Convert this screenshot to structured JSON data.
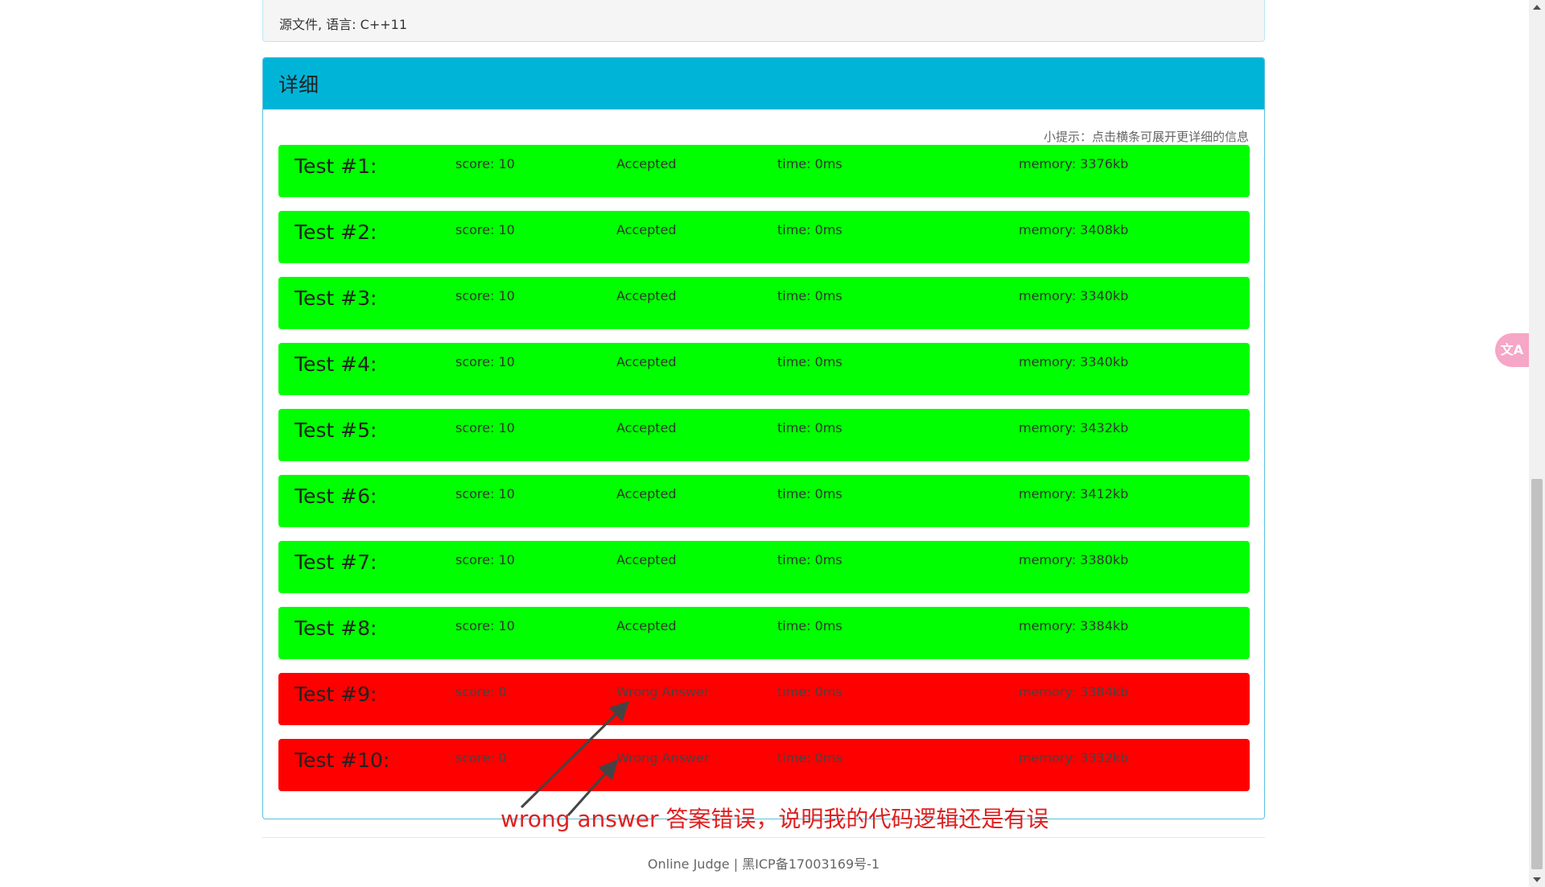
{
  "source_panel": {
    "text": "源文件, 语言: C++11"
  },
  "detail": {
    "title": "详细",
    "hint": "小提示：点击横条可展开更详细的信息",
    "tests": [
      {
        "name": "Test #1:",
        "score": "score: 10",
        "status": "Accepted",
        "time": "time: 0ms",
        "memory": "memory: 3376kb",
        "result": "ok"
      },
      {
        "name": "Test #2:",
        "score": "score: 10",
        "status": "Accepted",
        "time": "time: 0ms",
        "memory": "memory: 3408kb",
        "result": "ok"
      },
      {
        "name": "Test #3:",
        "score": "score: 10",
        "status": "Accepted",
        "time": "time: 0ms",
        "memory": "memory: 3340kb",
        "result": "ok"
      },
      {
        "name": "Test #4:",
        "score": "score: 10",
        "status": "Accepted",
        "time": "time: 0ms",
        "memory": "memory: 3340kb",
        "result": "ok"
      },
      {
        "name": "Test #5:",
        "score": "score: 10",
        "status": "Accepted",
        "time": "time: 0ms",
        "memory": "memory: 3432kb",
        "result": "ok"
      },
      {
        "name": "Test #6:",
        "score": "score: 10",
        "status": "Accepted",
        "time": "time: 0ms",
        "memory": "memory: 3412kb",
        "result": "ok"
      },
      {
        "name": "Test #7:",
        "score": "score: 10",
        "status": "Accepted",
        "time": "time: 0ms",
        "memory": "memory: 3380kb",
        "result": "ok"
      },
      {
        "name": "Test #8:",
        "score": "score: 10",
        "status": "Accepted",
        "time": "time: 0ms",
        "memory": "memory: 3384kb",
        "result": "ok"
      },
      {
        "name": "Test #9:",
        "score": "score: 0",
        "status": "Wrong Answer",
        "time": "time: 0ms",
        "memory": "memory: 3384kb",
        "result": "bad"
      },
      {
        "name": "Test #10:",
        "score": "score: 0",
        "status": "Wrong Answer",
        "time": "time: 0ms",
        "memory": "memory: 3332kb",
        "result": "bad"
      }
    ]
  },
  "annotation": {
    "text": "wrong answer 答案错误，说明我的代码逻辑还是有误",
    "color": "#e02020"
  },
  "footer": {
    "text": "Online Judge | 黑ICP备17003169号-1"
  },
  "translate_widget": {
    "label": "文A",
    "icon": "translate-icon"
  },
  "colors": {
    "accepted": "#00ff00",
    "wrong": "#ff0000",
    "header": "#00b4d8"
  }
}
